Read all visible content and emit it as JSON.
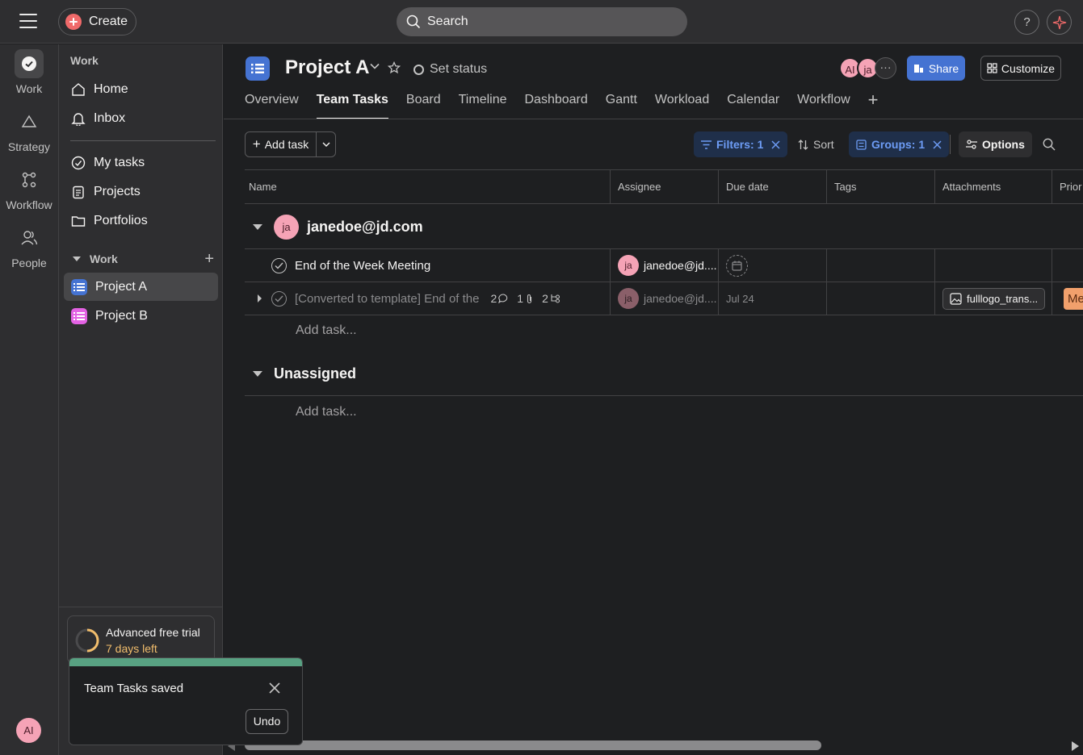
{
  "topbar": {
    "create_label": "Create",
    "search_label": "Search",
    "help_label": "?"
  },
  "rail": {
    "items": [
      {
        "label": "Work",
        "icon": "check-circle-icon"
      },
      {
        "label": "Strategy",
        "icon": "triangle-icon"
      },
      {
        "label": "Workflow",
        "icon": "workflow-icon"
      },
      {
        "label": "People",
        "icon": "people-icon"
      }
    ],
    "user_initials": "AI"
  },
  "sidebar": {
    "heading": "Work",
    "nav": [
      {
        "label": "Home",
        "icon": "home-icon"
      },
      {
        "label": "Inbox",
        "icon": "bell-icon"
      },
      {
        "label": "My tasks",
        "icon": "check-circle-icon"
      },
      {
        "label": "Projects",
        "icon": "clipboard-icon"
      },
      {
        "label": "Portfolios",
        "icon": "folder-icon"
      }
    ],
    "section_label": "Work",
    "projects": [
      {
        "label": "Project A",
        "color": "#4573d2"
      },
      {
        "label": "Project B",
        "color": "#e362e3"
      }
    ],
    "trial": {
      "title": "Advanced free trial",
      "days_left": "7 days left"
    }
  },
  "project": {
    "title": "Project A",
    "set_status": "Set status",
    "members": [
      "AI",
      "ja"
    ],
    "share_label": "Share",
    "customize_label": "Customize",
    "tabs": [
      "Overview",
      "Team Tasks",
      "Board",
      "Timeline",
      "Dashboard",
      "Gantt",
      "Workload",
      "Calendar",
      "Workflow"
    ],
    "active_tab": "Team Tasks"
  },
  "toolbar": {
    "add_task_label": "Add task",
    "filters_label": "Filters: 1",
    "sort_label": "Sort",
    "groups_label": "Groups: 1",
    "options_label": "Options"
  },
  "table": {
    "columns": [
      "Name",
      "Assignee",
      "Due date",
      "Tags",
      "Attachments",
      "Prior"
    ],
    "groups": [
      {
        "name": "janedoe@jd.com",
        "avatar": "ja",
        "tasks": [
          {
            "name": "End of the Week Meeting",
            "assignee": "janedoe@jd....",
            "assignee_initials": "ja",
            "due_date": "",
            "attachment": "",
            "priority": ""
          },
          {
            "name": "[Converted to template] End of the",
            "comments": "2",
            "attachments_count": "1",
            "subtasks": "2",
            "assignee": "janedoe@jd....",
            "assignee_initials": "ja",
            "due_date": "Jul 24",
            "attachment": "fulllogo_trans...",
            "priority": "Me"
          }
        ],
        "add_task_label": "Add task..."
      },
      {
        "name": "Unassigned",
        "add_task_label": "Add task..."
      }
    ]
  },
  "toast": {
    "message": "Team Tasks saved",
    "undo_label": "Undo"
  }
}
